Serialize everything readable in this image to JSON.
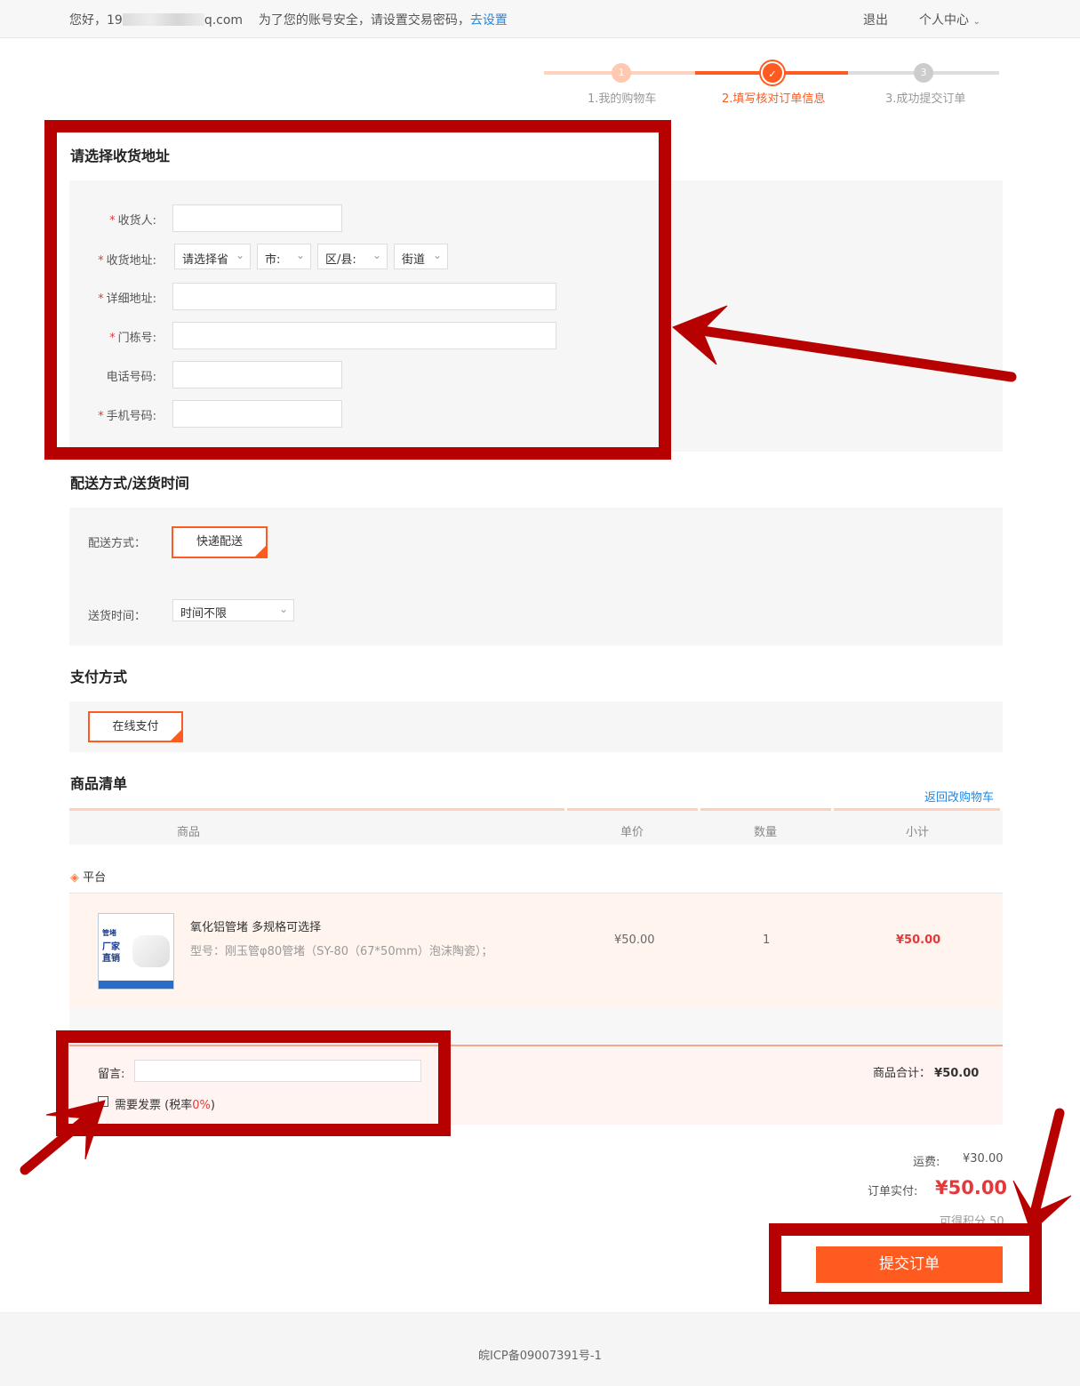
{
  "topbar": {
    "greeting": "您好，19",
    "email_suffix": "q.com",
    "security_msg": "为了您的账号安全，请设置交易密码，",
    "set_link": "去设置",
    "logout": "退出",
    "user_center": "个人中心",
    "user_center_icon": "chevron-down-icon"
  },
  "steps": [
    {
      "num": "1",
      "label": "1.我的购物车"
    },
    {
      "num": "✓",
      "label": "2.填写核对订单信息"
    },
    {
      "num": "3",
      "label": "3.成功提交订单"
    }
  ],
  "address": {
    "title": "请选择收货地址",
    "receiver_label": "收货人:",
    "region_label": "收货地址:",
    "province": "请选择省",
    "city": "市:",
    "district": "区/县:",
    "street": "街道",
    "detail_label": "详细地址:",
    "door_label": "门栋号:",
    "phone_label": "电话号码:",
    "mobile_label": "手机号码:",
    "required_mark": "*"
  },
  "delivery": {
    "title": "配送方式/送货时间",
    "method_label": "配送方式：",
    "method_value": "快递配送",
    "time_label": "送货时间：",
    "time_value": "时间不限"
  },
  "payment": {
    "title": "支付方式",
    "method": "在线支付"
  },
  "goods": {
    "title": "商品清单",
    "back_link": "返回改购物车",
    "columns": [
      "商品",
      "单价",
      "数量",
      "小计"
    ],
    "shop_name": "平台",
    "shop_icon": "layers-icon",
    "item": {
      "name": "氧化铝管堵 多规格可选择",
      "spec": "型号：刚玉管φ80管堵（SY-80（67*50mm）泡沫陶瓷）；",
      "price": "¥50.00",
      "qty": "1",
      "subtotal": "¥50.00",
      "thumb_text_1": "管堵",
      "thumb_text_2": "厂家",
      "thumb_text_3": "直销"
    }
  },
  "note": {
    "label": "留言:",
    "invoice_label": "需要发票",
    "tax_prefix": "(税率",
    "tax_rate": "0%",
    "tax_suffix": ")",
    "goods_total_label": "商品合计：",
    "goods_total": "¥50.00"
  },
  "summary": {
    "freight_label": "运费:",
    "freight": "¥30.00",
    "paid_label": "订单实付:",
    "paid": "¥50.00",
    "points": "可得积分 50",
    "submit": "提交订单"
  },
  "footer": {
    "icp": "皖ICP备09007391号-1"
  },
  "colors": {
    "accent": "#ff5a1f",
    "price_red": "#e4393c",
    "annotation_red": "#b70000",
    "link_blue": "#1e88e5"
  }
}
